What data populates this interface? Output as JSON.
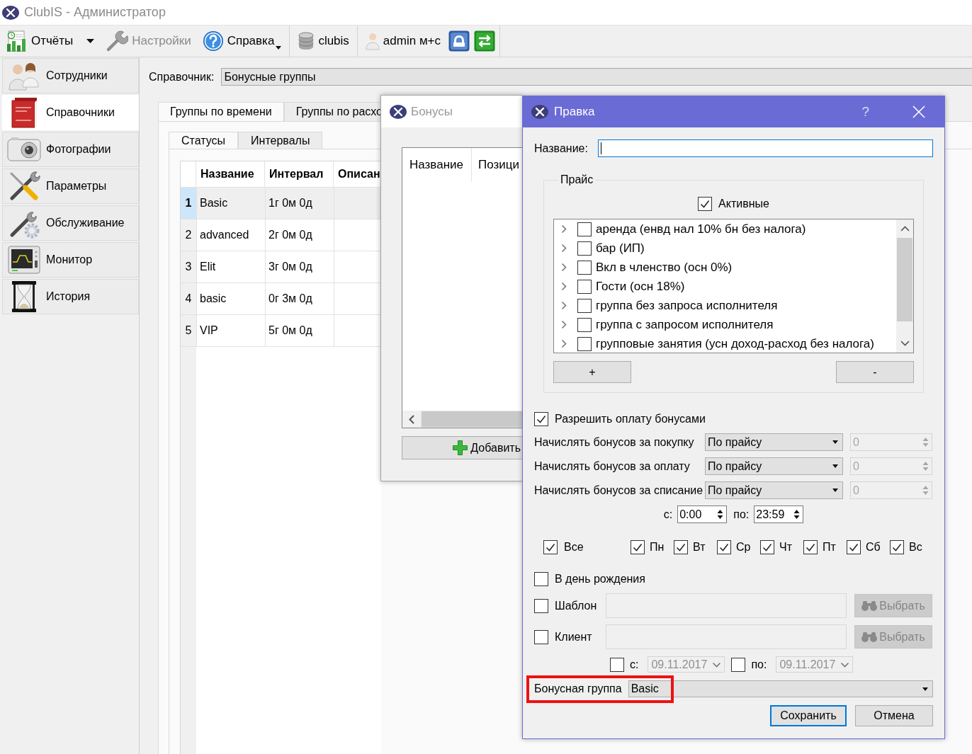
{
  "window": {
    "title": "ClubIS - Администратор"
  },
  "toolbar": [
    [
      {
        "kind": "dropdown",
        "label": "Отчёты",
        "disabled": false
      },
      {
        "kind": "button",
        "label": "Настройки",
        "disabled": true
      },
      {
        "kind": "menu",
        "label": "Справка",
        "disabled": false
      }
    ],
    [
      {
        "kind": "label",
        "label": "clubis",
        "disabled": false
      }
    ],
    [
      {
        "kind": "label",
        "label": "admin м+с",
        "disabled": false
      },
      {
        "kind": "icon",
        "disabled": false
      },
      {
        "kind": "icon",
        "disabled": false
      }
    ]
  ],
  "sidebar": [
    {
      "label": "Сотрудники",
      "selected": false
    },
    {
      "label": "Справочники",
      "selected": true
    },
    {
      "label": "Фотографии",
      "selected": false
    },
    {
      "label": "Параметры",
      "selected": false
    },
    {
      "label": "Обслуживание",
      "selected": false
    },
    {
      "label": "Монитор",
      "selected": false
    },
    {
      "label": "История",
      "selected": false
    }
  ],
  "reference": {
    "label": "Справочник:",
    "value": "Бонусные группы"
  },
  "tabs": [
    {
      "label": "Группы по времени",
      "selected": true
    },
    {
      "label": "Группы по расхо",
      "selected": false
    }
  ],
  "subtabs": [
    {
      "label": "Статусы",
      "selected": true
    },
    {
      "label": "Интервалы",
      "selected": false
    }
  ],
  "table": {
    "columns": [
      "Название",
      "Интервал",
      "Описан"
    ],
    "rows": [
      {
        "number": "1",
        "name": "Basic",
        "interval": "1г 0м 0д",
        "selected": true
      },
      {
        "number": "2",
        "name": "advanced",
        "interval": "2г 0м 0д",
        "selected": false
      },
      {
        "number": "3",
        "name": "Elit",
        "interval": "3г 0м 0д",
        "selected": false
      },
      {
        "number": "4",
        "name": "basic",
        "interval": "0г 3м 0д",
        "selected": false
      },
      {
        "number": "5",
        "name": "VIP",
        "interval": "5г 0м 0д",
        "selected": false
      }
    ]
  },
  "bonuses": {
    "title": "Бонусы",
    "active": false,
    "columns": [
      "Название",
      "Позици"
    ],
    "add_button": "Добавить"
  },
  "edit": {
    "title": "Правка",
    "active": true,
    "help": "?",
    "name_label": "Название:",
    "name_focused": true,
    "price": {
      "title": "Прайс",
      "active": {
        "label": "Активные",
        "checked": true
      },
      "items": [
        {
          "label": "аренда (енвд нал 10% бн без налога)",
          "checked": false,
          "expanded": false
        },
        {
          "label": "бар (ИП)",
          "checked": false,
          "expanded": false
        },
        {
          "label": "Вкл в членство (осн 0%)",
          "checked": false,
          "expanded": false
        },
        {
          "label": "Гости (осн 18%)",
          "checked": false,
          "expanded": false
        },
        {
          "label": "группа без запроса исполнителя",
          "checked": false,
          "expanded": false
        },
        {
          "label": "группа с запросом исполнителя",
          "checked": false,
          "expanded": false
        },
        {
          "label": "групповые занятия (усн доход-расход без налога)",
          "checked": false,
          "expanded": false
        }
      ],
      "add": "+",
      "remove": "-"
    },
    "allow_payment": {
      "label": "Разрешить оплату бонусами",
      "checked": true
    },
    "accruals": [
      {
        "label": "Начислять бонусов за покупку",
        "mode": "По прайсу",
        "amount": "0",
        "amount_disabled": true
      },
      {
        "label": "Начислять бонусов за оплату",
        "mode": "По прайсу",
        "amount": "0",
        "amount_disabled": true
      },
      {
        "label": "Начислять бонусов за списание",
        "mode": "По прайсу",
        "amount": "0",
        "amount_disabled": true
      }
    ],
    "time": {
      "from_label": "с:",
      "from": "0:00",
      "to_label": "по:",
      "to": "23:59"
    },
    "all_days": {
      "label": "Все",
      "checked": true
    },
    "days": [
      {
        "label": "Пн",
        "checked": true
      },
      {
        "label": "Вт",
        "checked": true
      },
      {
        "label": "Ср",
        "checked": true
      },
      {
        "label": "Чт",
        "checked": true
      },
      {
        "label": "Пт",
        "checked": true
      },
      {
        "label": "Сб",
        "checked": true
      },
      {
        "label": "Вс",
        "checked": true
      }
    ],
    "birthday": {
      "label": "В день рождения",
      "checked": false
    },
    "pickers": [
      {
        "label": "Шаблон",
        "checked": false,
        "button": "Выбрать",
        "disabled": true
      },
      {
        "label": "Клиент",
        "checked": false,
        "button": "Выбрать",
        "disabled": true
      }
    ],
    "period": {
      "disabled": true,
      "from": {
        "label": "с:",
        "checked": false,
        "value": "09.11.2017"
      },
      "to": {
        "label": "по:",
        "checked": false,
        "value": "09.11.2017"
      }
    },
    "bonus_group": {
      "label": "Бонусная группа",
      "value": "Basic",
      "highlighted": true
    },
    "buttons": [
      {
        "label": "Сохранить",
        "default": true
      },
      {
        "label": "Отмена",
        "default": false
      }
    ]
  }
}
